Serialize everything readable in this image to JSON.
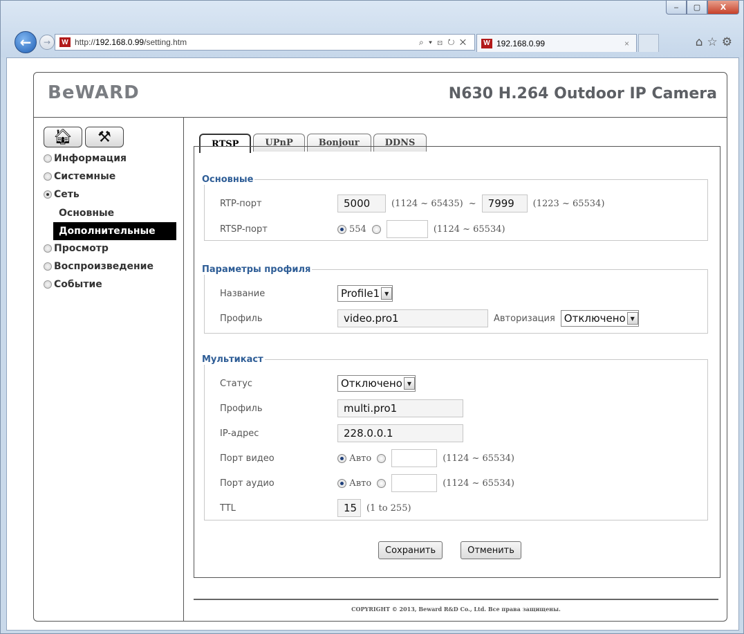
{
  "browser": {
    "url_prefix": "http://",
    "url_host": "192.168.0.99",
    "url_path": "/setting.htm",
    "addr_tools": "⌕ ▾ ⊡ ↻ ✕",
    "tab_title": "192.168.0.99",
    "tab_close": "×",
    "window_min": "‒",
    "window_max": "▢",
    "window_close": "X"
  },
  "header": {
    "logo": "BeWARD",
    "camera_title": "N630 H.264 Outdoor IP Camera"
  },
  "sidebar": {
    "items": [
      {
        "label": "Информация",
        "selected": false
      },
      {
        "label": "Системные",
        "selected": false
      },
      {
        "label": "Сеть",
        "selected": true
      },
      {
        "label": "Просмотр",
        "selected": false
      },
      {
        "label": "Воспроизведение",
        "selected": false
      },
      {
        "label": "Событие",
        "selected": false
      }
    ],
    "subitems": [
      {
        "label": "Основные",
        "active": false
      },
      {
        "label": "Дополнительные",
        "active": true
      }
    ]
  },
  "tabs": [
    "RTSP",
    "UPnP",
    "Bonjour",
    "DDNS"
  ],
  "basic": {
    "legend": "Основные",
    "rtp_label": "RTP-порт",
    "rtp_from": "5000",
    "rtp_from_range": "(1124 ~ 65435)",
    "rtp_sep": "~",
    "rtp_to": "7999",
    "rtp_to_range": "(1223 ~ 65534)",
    "rtsp_label": "RTSP-порт",
    "rtsp_default": "554",
    "rtsp_range": "(1124 ~ 65534)"
  },
  "profile": {
    "legend": "Параметры профиля",
    "name_label": "Название",
    "name_value": "Profile1",
    "profile_label": "Профиль",
    "profile_value": "video.pro1",
    "auth_label": "Авторизация",
    "auth_value": "Отключено"
  },
  "multicast": {
    "legend": "Мультикаст",
    "status_label": "Статус",
    "status_value": "Отключено",
    "profile_label": "Профиль",
    "profile_value": "multi.pro1",
    "ip_label": "IP-адрес",
    "ip_value": "228.0.0.1",
    "video_label": "Порт видео",
    "video_auto": "Авто",
    "video_range": "(1124 ~ 65534)",
    "audio_label": "Порт аудио",
    "audio_auto": "Авто",
    "audio_range": "(1124 ~ 65534)",
    "ttl_label": "TTL",
    "ttl_value": "15",
    "ttl_range": "(1 to 255)"
  },
  "buttons": {
    "save": "Сохранить",
    "cancel": "Отменить"
  },
  "footer": {
    "copyright": "COPYRIGHT © 2013, Beward R&D Co., Ltd. Все права защищены."
  }
}
